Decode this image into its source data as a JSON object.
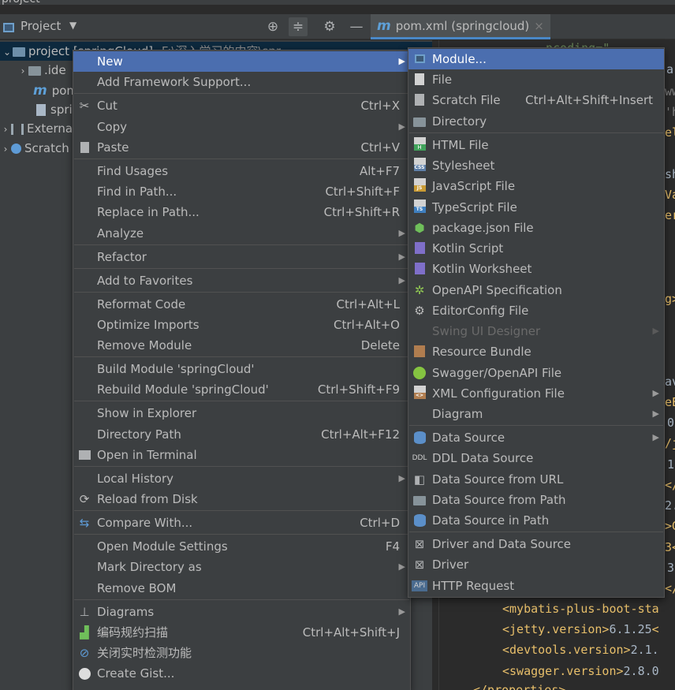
{
  "window": {
    "title": "project"
  },
  "toolwindow": {
    "title": "Project",
    "caret": "▼",
    "locate_icon": "⊕",
    "collapse_icon": "≑",
    "settings_icon": "⚙",
    "hide_icon": "—"
  },
  "editor_tab": {
    "file_icon": "m",
    "label": "pom.xml (springcloud)",
    "close": "×"
  },
  "tree": {
    "root_label": "project [springCloud]",
    "root_path": "F:\\深入学习的内容\\spr",
    "items": [
      ".ide",
      "pom",
      "spri"
    ],
    "external": "Externa",
    "scratches": "Scratch"
  },
  "editor_lines": [
    {
      "tag_open": "<mybatis-plus-boot-sta",
      "value": "",
      "tag_close": ""
    },
    {
      "tag_open": "<jetty.version>",
      "value": "6.1.25",
      "tag_close": "<"
    },
    {
      "tag_open": "<devtools.version>",
      "value": "2.1.",
      "tag_close": ""
    },
    {
      "tag_open": "<swagger.version>",
      "value": "2.8.0",
      "tag_close": ""
    },
    {
      "tag_open": "</properties>",
      "value": "",
      "tag_close": ""
    }
  ],
  "editor_fragments": [
    "ncoding=\"",
    "a",
    "ww",
    "'h",
    "el",
    "sh",
    "Va",
    "er",
    "g>",
    "av",
    "eE",
    "0",
    "/j",
    "1",
    "</",
    "2.",
    ">G",
    "3<",
    "3",
    "</"
  ],
  "context_menu": {
    "items": [
      {
        "label": "New",
        "shortcut": "",
        "submenu": true
      },
      {
        "label": "Add Framework Support...",
        "shortcut": "",
        "submenu": false
      },
      {
        "label": "Cut",
        "shortcut": "Ctrl+X",
        "icon": "✂"
      },
      {
        "label": "Copy",
        "shortcut": "",
        "submenu": true
      },
      {
        "label": "Paste",
        "shortcut": "Ctrl+V",
        "icon": "📋"
      },
      {
        "label": "Find Usages",
        "shortcut": "Alt+F7"
      },
      {
        "label": "Find in Path...",
        "shortcut": "Ctrl+Shift+F"
      },
      {
        "label": "Replace in Path...",
        "shortcut": "Ctrl+Shift+R"
      },
      {
        "label": "Analyze",
        "shortcut": "",
        "submenu": true
      },
      {
        "label": "Refactor",
        "shortcut": "",
        "submenu": true
      },
      {
        "label": "Add to Favorites",
        "shortcut": "",
        "submenu": true
      },
      {
        "label": "Reformat Code",
        "shortcut": "Ctrl+Alt+L"
      },
      {
        "label": "Optimize Imports",
        "shortcut": "Ctrl+Alt+O"
      },
      {
        "label": "Remove Module",
        "shortcut": "Delete"
      },
      {
        "label": "Build Module 'springCloud'",
        "shortcut": ""
      },
      {
        "label": "Rebuild Module 'springCloud'",
        "shortcut": "Ctrl+Shift+F9"
      },
      {
        "label": "Show in Explorer",
        "shortcut": ""
      },
      {
        "label": "Directory Path",
        "shortcut": "Ctrl+Alt+F12"
      },
      {
        "label": "Open in Terminal",
        "shortcut": ""
      },
      {
        "label": "Local History",
        "shortcut": "",
        "submenu": true
      },
      {
        "label": "Reload from Disk",
        "shortcut": ""
      },
      {
        "label": "Compare With...",
        "shortcut": "Ctrl+D"
      },
      {
        "label": "Open Module Settings",
        "shortcut": "F4"
      },
      {
        "label": "Mark Directory as",
        "shortcut": "",
        "submenu": true
      },
      {
        "label": "Remove BOM",
        "shortcut": ""
      },
      {
        "label": "Diagrams",
        "shortcut": "",
        "submenu": true
      },
      {
        "label": "编码规约扫描",
        "shortcut": "Ctrl+Alt+Shift+J"
      },
      {
        "label": "关闭实时检测功能",
        "shortcut": ""
      },
      {
        "label": "Create Gist...",
        "shortcut": ""
      }
    ]
  },
  "new_submenu": {
    "items": [
      {
        "label": "Module...",
        "shortcut": ""
      },
      {
        "label": "File",
        "shortcut": ""
      },
      {
        "label": "Scratch File",
        "shortcut": "Ctrl+Alt+Shift+Insert"
      },
      {
        "label": "Directory",
        "shortcut": ""
      },
      {
        "label": "HTML File",
        "shortcut": ""
      },
      {
        "label": "Stylesheet",
        "shortcut": ""
      },
      {
        "label": "JavaScript File",
        "shortcut": ""
      },
      {
        "label": "TypeScript File",
        "shortcut": ""
      },
      {
        "label": "package.json File",
        "shortcut": ""
      },
      {
        "label": "Kotlin Script",
        "shortcut": ""
      },
      {
        "label": "Kotlin Worksheet",
        "shortcut": ""
      },
      {
        "label": "OpenAPI Specification",
        "shortcut": ""
      },
      {
        "label": "EditorConfig File",
        "shortcut": ""
      },
      {
        "label": "Swing UI Designer",
        "shortcut": ""
      },
      {
        "label": "Resource Bundle",
        "shortcut": ""
      },
      {
        "label": "Swagger/OpenAPI File",
        "shortcut": ""
      },
      {
        "label": "XML Configuration File",
        "shortcut": ""
      },
      {
        "label": "Diagram",
        "shortcut": ""
      },
      {
        "label": "Data Source",
        "shortcut": ""
      },
      {
        "label": "DDL Data Source",
        "shortcut": ""
      },
      {
        "label": "Data Source from URL",
        "shortcut": ""
      },
      {
        "label": "Data Source from Path",
        "shortcut": ""
      },
      {
        "label": "Data Source in Path",
        "shortcut": ""
      },
      {
        "label": "Driver and Data Source",
        "shortcut": ""
      },
      {
        "label": "Driver",
        "shortcut": ""
      },
      {
        "label": "HTTP Request",
        "shortcut": ""
      }
    ]
  },
  "colors": {
    "menu_bg": "#3c3f41",
    "highlight": "#4b6eaf",
    "text": "#bbbbbb",
    "disabled": "#6a6a6a",
    "editor_bg": "#2b2b2b",
    "xml_tag": "#e8bf6a"
  }
}
